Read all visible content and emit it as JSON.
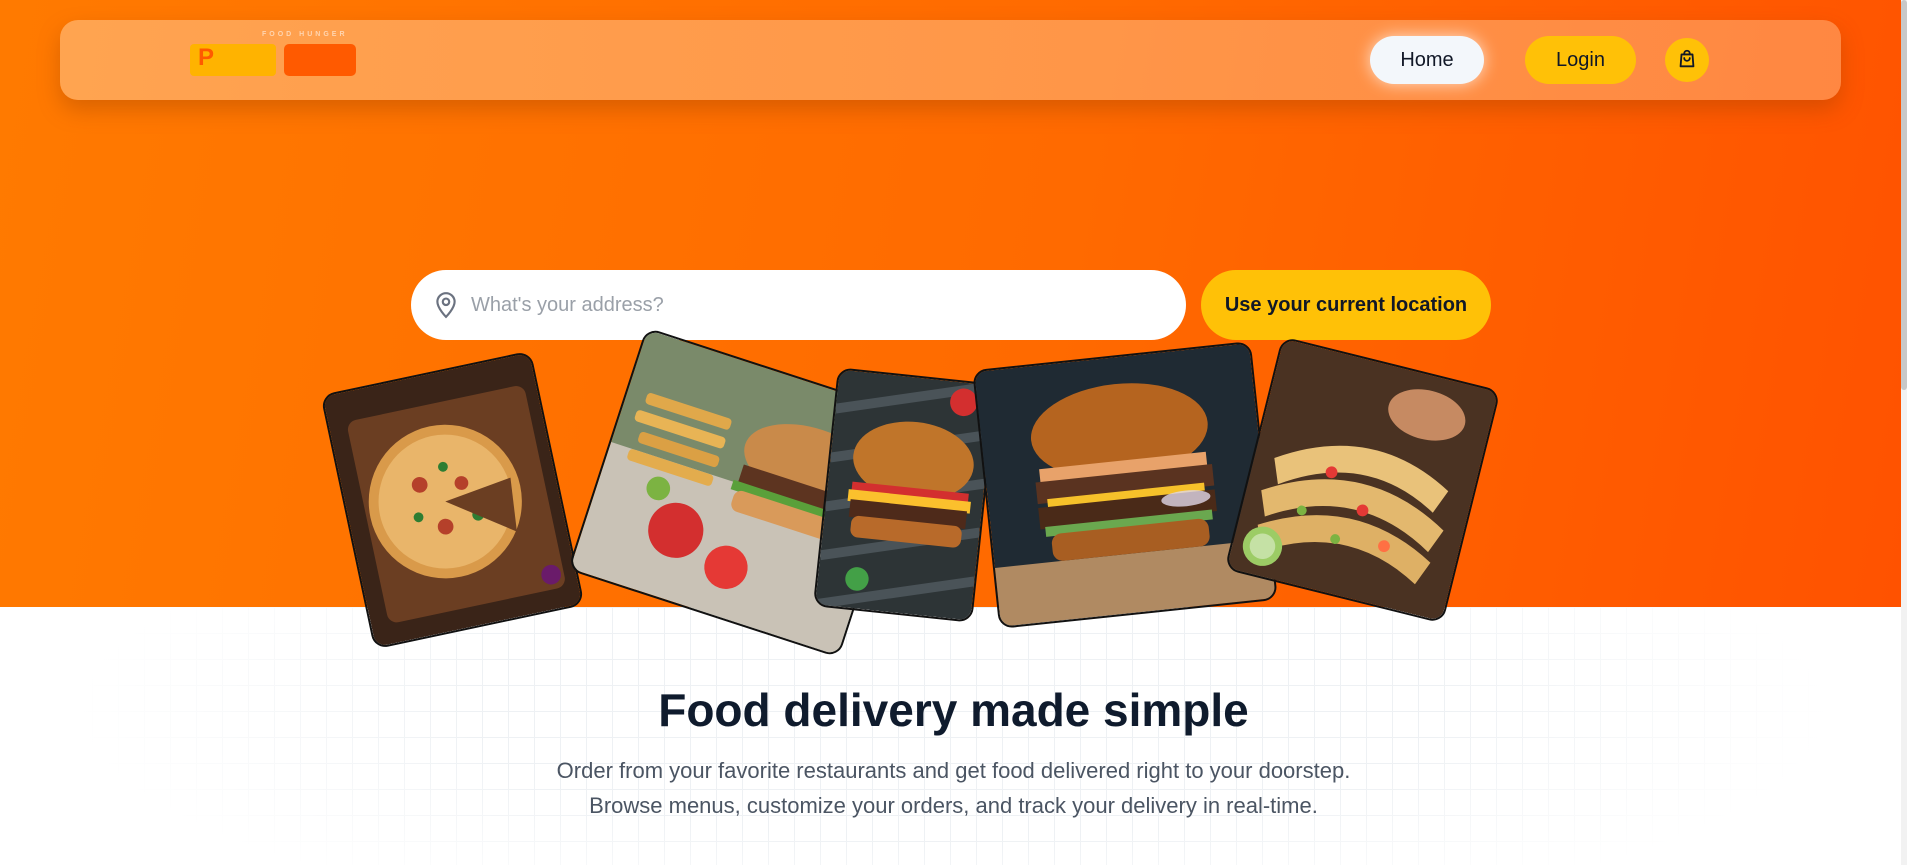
{
  "nav": {
    "logo_tagline": "FOOD HUNGER",
    "logo_letter": "P",
    "home_label": "Home",
    "login_label": "Login",
    "cart_icon": "shopping-bag-icon"
  },
  "hero": {
    "search_placeholder": "What's your address?",
    "search_value": "",
    "location_button_label": "Use your current location",
    "photos": [
      "pizza",
      "burger-with-fries",
      "cheeseburger",
      "double-burger",
      "tacos"
    ]
  },
  "intro": {
    "headline": "Food delivery made simple",
    "line1": "Order from your favorite restaurants and get food delivered right to your doorstep.",
    "line2": "Browse menus, customize your orders, and track your delivery in real-time."
  },
  "colors": {
    "hero_orange": "#ff6a00",
    "accent_yellow": "#ffc107",
    "heading_navy": "#0f1b2d"
  }
}
